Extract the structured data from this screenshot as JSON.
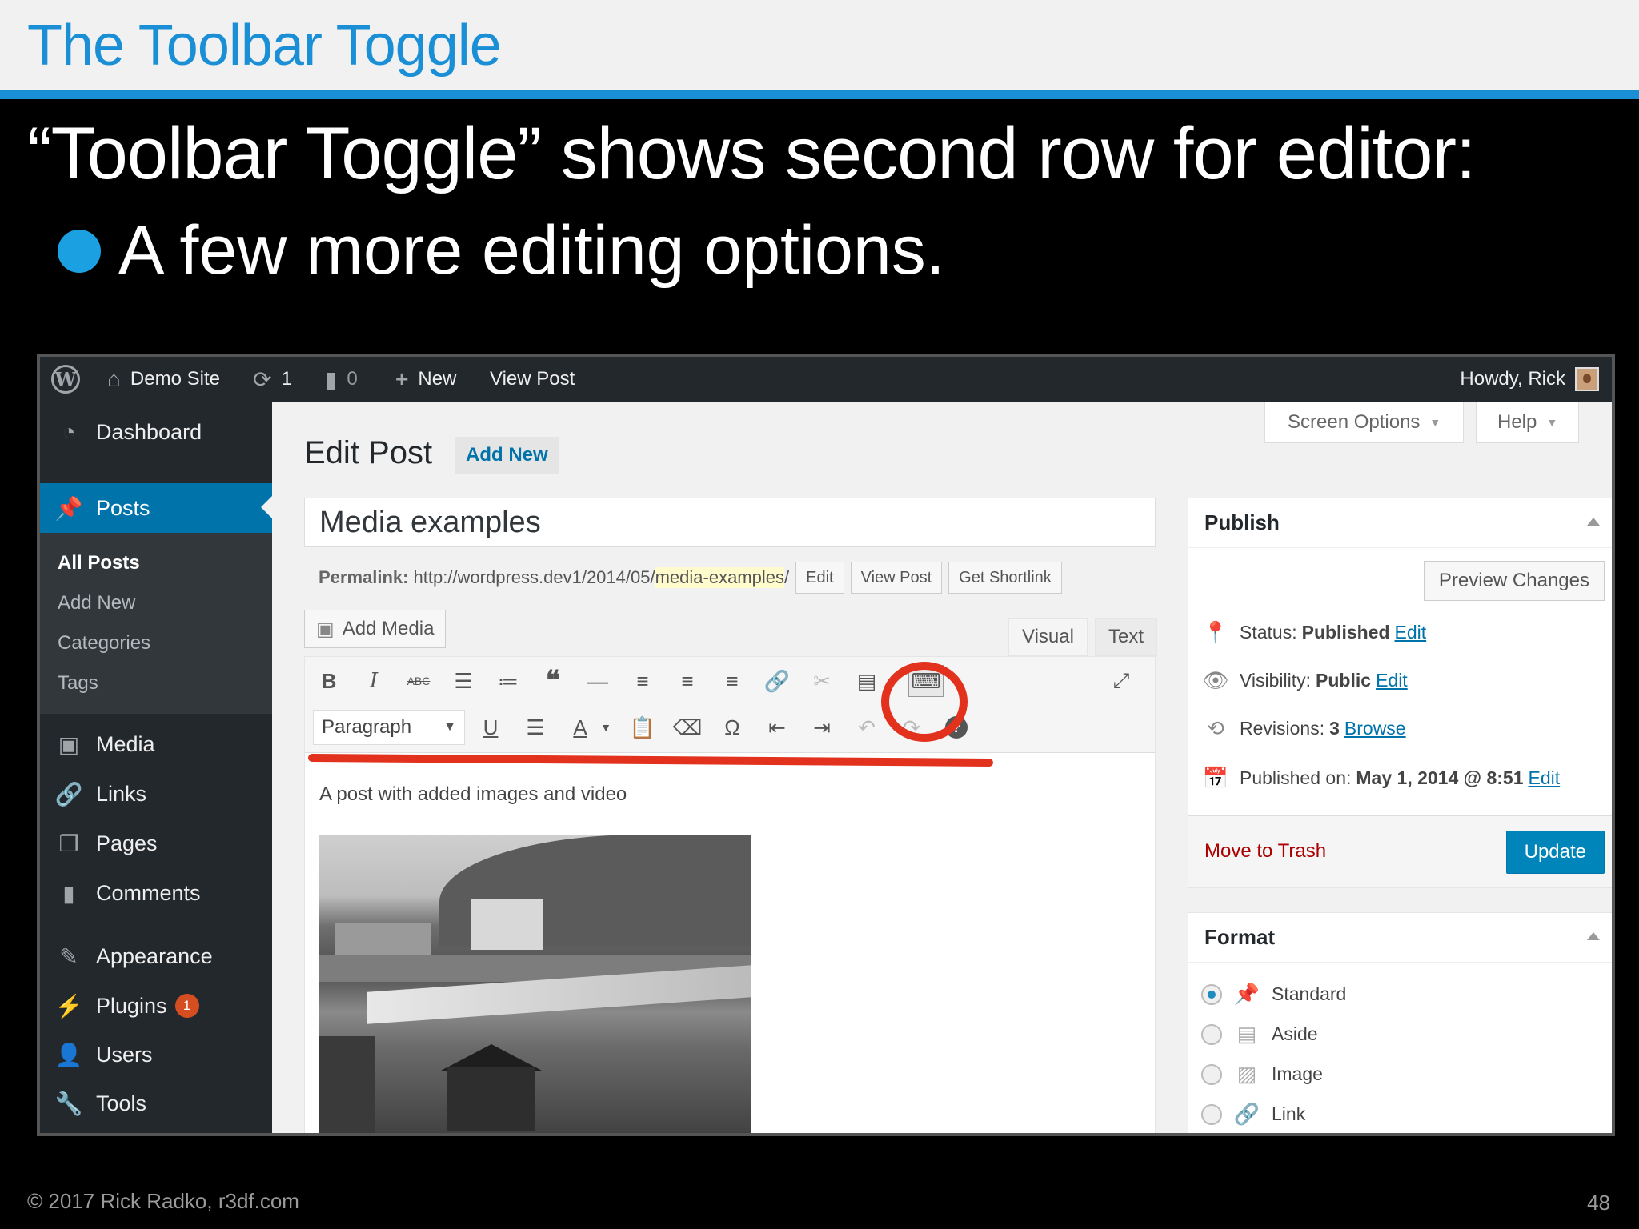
{
  "slide": {
    "title": "The Toolbar Toggle",
    "headline": "“Toolbar Toggle” shows second row for editor:",
    "bullet": "A few more editing options.",
    "footer": "© 2017 Rick Radko, r3df.com",
    "page_number": "48",
    "colors": {
      "accent": "#1a8fd6",
      "annotation": "#e2311d"
    }
  },
  "adminbar": {
    "site_name": "Demo Site",
    "updates_count": "1",
    "comments_count": "0",
    "new_label": "New",
    "view_post_label": "View Post",
    "greeting": "Howdy, Rick"
  },
  "sidebar": {
    "items": [
      {
        "label": "Dashboard",
        "icon": "dashboard-icon"
      },
      {
        "label": "Posts",
        "icon": "pin-icon"
      },
      {
        "label": "Media",
        "icon": "media-icon"
      },
      {
        "label": "Links",
        "icon": "link-icon"
      },
      {
        "label": "Pages",
        "icon": "pages-icon"
      },
      {
        "label": "Comments",
        "icon": "comment-icon"
      },
      {
        "label": "Appearance",
        "icon": "brush-icon"
      },
      {
        "label": "Plugins",
        "icon": "plugin-icon",
        "badge": "1"
      },
      {
        "label": "Users",
        "icon": "users-icon"
      },
      {
        "label": "Tools",
        "icon": "wrench-icon"
      }
    ],
    "submenu": [
      "All Posts",
      "Add New",
      "Categories",
      "Tags"
    ]
  },
  "main": {
    "screen_options": "Screen Options",
    "help": "Help",
    "page_title": "Edit Post",
    "add_new": "Add New",
    "post_title": "Media examples",
    "permalink_label": "Permalink:",
    "permalink_base": "http://wordpress.dev1/2014/05/",
    "permalink_slug": "media-examples",
    "permalink_trail": "/",
    "permalink_edit": "Edit",
    "permalink_view": "View Post",
    "permalink_shortlink": "Get Shortlink",
    "add_media": "Add Media",
    "tab_visual": "Visual",
    "tab_text": "Text",
    "format_select": "Paragraph",
    "content_text": "A post with added images and video"
  },
  "publish": {
    "title": "Publish",
    "preview": "Preview Changes",
    "status_label": "Status:",
    "status_value": "Published",
    "visibility_label": "Visibility:",
    "visibility_value": "Public",
    "revisions_label": "Revisions:",
    "revisions_value": "3",
    "revisions_link": "Browse",
    "published_label": "Published on:",
    "published_value": "May 1, 2014 @ 8:51",
    "edit_link": "Edit",
    "trash": "Move to Trash",
    "update": "Update"
  },
  "format": {
    "title": "Format",
    "options": [
      "Standard",
      "Aside",
      "Image",
      "Link"
    ],
    "selected": "Standard"
  }
}
